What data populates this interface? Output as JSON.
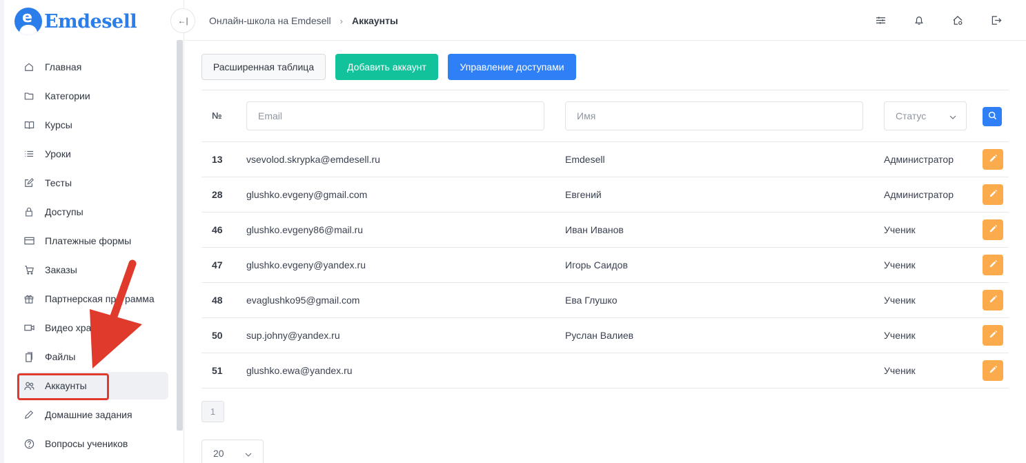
{
  "brand": {
    "name": "Emdesell",
    "color": "#2b7de9",
    "mark_letter": "e"
  },
  "sidebar": {
    "items": [
      {
        "label": "Главная",
        "icon": "home-icon"
      },
      {
        "label": "Категории",
        "icon": "folder-icon"
      },
      {
        "label": "Курсы",
        "icon": "book-icon"
      },
      {
        "label": "Уроки",
        "icon": "list-icon"
      },
      {
        "label": "Тесты",
        "icon": "edit-icon"
      },
      {
        "label": "Доступы",
        "icon": "lock-icon"
      },
      {
        "label": "Платежные формы",
        "icon": "card-icon"
      },
      {
        "label": "Заказы",
        "icon": "cart-icon"
      },
      {
        "label": "Партнерская программа",
        "icon": "gift-icon"
      },
      {
        "label": "Видео хранилище",
        "icon": "video-icon"
      },
      {
        "label": "Файлы",
        "icon": "files-icon"
      },
      {
        "label": "Аккаунты",
        "icon": "users-icon",
        "active": true
      },
      {
        "label": "Домашние задания",
        "icon": "pencil-icon"
      },
      {
        "label": "Вопросы учеников",
        "icon": "help-icon"
      }
    ],
    "highlight_color": "#e03a2c"
  },
  "header": {
    "collapse_glyph": "←|",
    "breadcrumb": {
      "parent": "Онлайн-школа на Emdesell",
      "separator": "›",
      "current": "Аккаунты"
    },
    "icons": [
      "sliders-icon",
      "bell-icon",
      "home-settings-icon",
      "logout-icon"
    ]
  },
  "toolbar": {
    "extended_table": "Расширенная таблица",
    "add_account": "Добавить аккаунт",
    "manage_access": "Управление доступами"
  },
  "filters": {
    "number_header": "№",
    "email_placeholder": "Email",
    "name_placeholder": "Имя",
    "status_placeholder": "Статус"
  },
  "rows": [
    {
      "id": "13",
      "email": "vsevolod.skrypka@emdesell.ru",
      "name": "Emdesell",
      "status": "Администратор"
    },
    {
      "id": "28",
      "email": "glushko.evgeny@gmail.com",
      "name": "Евгений",
      "status": "Администратор"
    },
    {
      "id": "46",
      "email": "glushko.evgeny86@mail.ru",
      "name": "Иван Иванов",
      "status": "Ученик"
    },
    {
      "id": "47",
      "email": "glushko.evgeny@yandex.ru",
      "name": "Игорь Саидов",
      "status": "Ученик"
    },
    {
      "id": "48",
      "email": "evaglushko95@gmail.com",
      "name": "Ева Глушко",
      "status": "Ученик"
    },
    {
      "id": "50",
      "email": "sup.johny@yandex.ru",
      "name": "Руслан Валиев",
      "status": "Ученик"
    },
    {
      "id": "51",
      "email": "glushko.ewa@yandex.ru",
      "name": "",
      "status": "Ученик"
    }
  ],
  "pagination": {
    "current_page": "1",
    "per_page": "20"
  },
  "colors": {
    "teal": "#12c29b",
    "blue": "#2f80f7",
    "edit": "#fbab4b",
    "arrow": "#e03a2c"
  }
}
